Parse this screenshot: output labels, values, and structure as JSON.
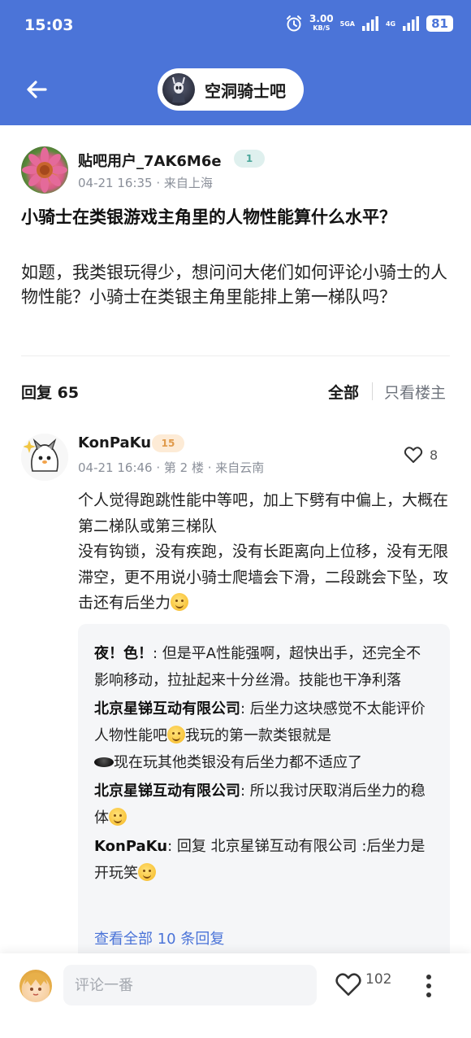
{
  "status_bar": {
    "time": "15:03",
    "net_speed": "3.00",
    "net_speed_unit": "KB/S",
    "net_tag_1": "5GA",
    "net_tag_2": "4G",
    "battery": "81"
  },
  "header": {
    "forum_name": "空洞骑士吧"
  },
  "post": {
    "author": "贴吧用户_7AK6M6e",
    "level": "1",
    "meta": "04-21 16:35 · 来自上海",
    "title": "小骑士在类银游戏主角里的人物性能算什么水平？",
    "body": "如题，我类银玩得少，想问问大佬们如何评论小骑士的人物性能？小骑士在类银主角里能排上第一梯队吗？"
  },
  "replies_bar": {
    "count_label": "回复 65",
    "filter_all": "全部",
    "filter_op": "只看楼主"
  },
  "comment": {
    "author": "KonPaKu",
    "level": "15",
    "meta": "04-21 16:46 · 第 2 楼 · 来自云南",
    "likes": "8",
    "body_line_1": "个人觉得跑跳性能中等吧，加上下劈有中偏上，大概在第二梯队或第三梯队",
    "body_line_2": "没有钩锁，没有疾跑，没有长距离向上位移，没有无限滞空，更不用说小骑士爬墙会下滑，二段跳会下坠，攻击还有后坐力",
    "sub_replies": [
      {
        "who": "夜！色！",
        "text": ": 但是平A性能强啊，超快出手，还完全不影响移动，拉扯起来十分丝滑。技能也干净利落"
      },
      {
        "who": "北京星锑互动有限公司",
        "text": ": 后坐力这块感觉不太能评价人物性能吧",
        "text_b": "我玩的第一款类银就是",
        "text_c": "现在玩其他类银没有后坐力都不适应了"
      },
      {
        "who": "北京星锑互动有限公司",
        "text": ": 所以我讨厌取消后坐力的稳体"
      },
      {
        "who": "KonPaKu",
        "text": ": 回复 北京星锑互动有限公司 :后坐力是开玩笑"
      }
    ],
    "see_all": "查看全部 10 条回复"
  },
  "bottom_bar": {
    "comment_placeholder": "评论一番",
    "likes": "102"
  },
  "colors": {
    "brand_blue": "#4b74d8",
    "link_blue": "#4b74d8"
  },
  "icons": [
    "back-arrow-icon",
    "heart-icon",
    "more-vertical-icon",
    "alarm-icon",
    "signal-icon"
  ]
}
